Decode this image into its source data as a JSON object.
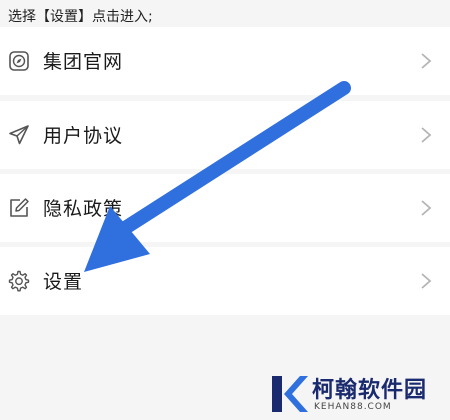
{
  "instruction": "选择【设置】点击进入;",
  "menu": {
    "items": [
      {
        "label": "集团官网",
        "icon": "compass-icon"
      },
      {
        "label": "用户协议",
        "icon": "paper-plane-icon"
      },
      {
        "label": "隐私政策",
        "icon": "edit-icon"
      },
      {
        "label": "设置",
        "icon": "gear-icon"
      }
    ]
  },
  "colors": {
    "arrow": "#2f6fde",
    "page_background": "#f5f5f5",
    "item_background": "#ffffff",
    "watermark": "#1a2a6e"
  },
  "watermark": {
    "brand": "柯翰软件园",
    "domain": "KEHAN88.COM"
  }
}
